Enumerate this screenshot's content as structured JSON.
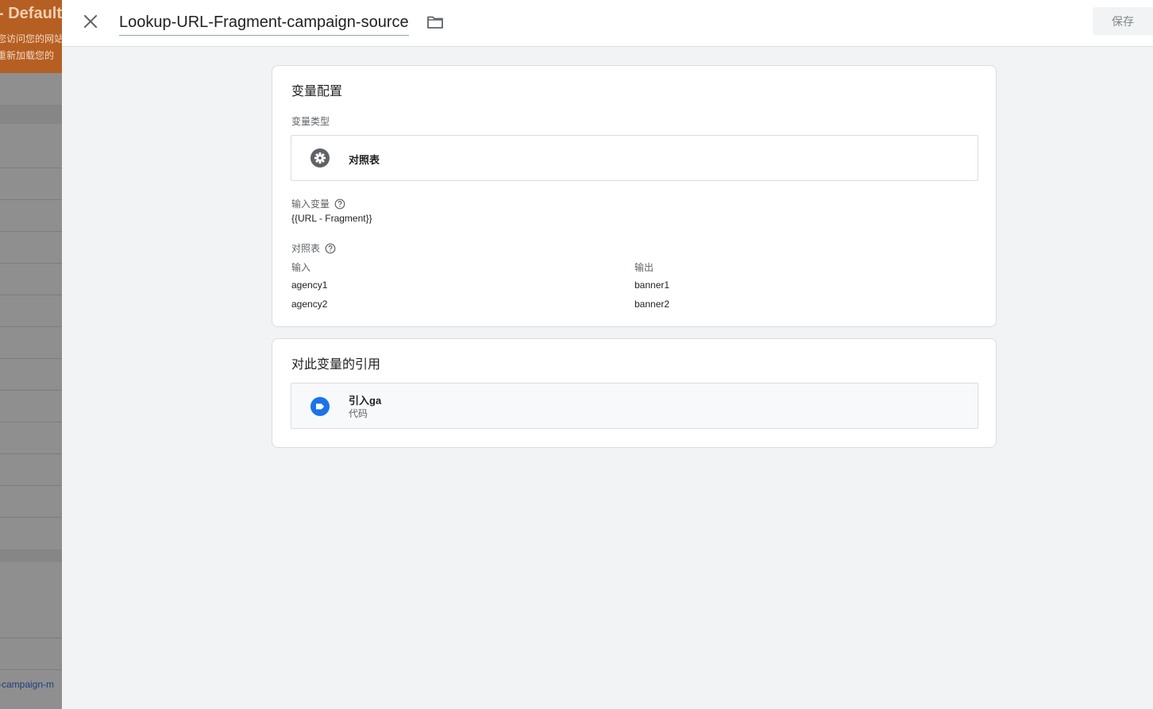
{
  "background": {
    "title": "- Default",
    "lines": [
      "您访问您的网站",
      "重新加载您的"
    ],
    "link": "-campaign-m"
  },
  "header": {
    "title": "Lookup-URL-Fragment-campaign-source",
    "save_label": "保存",
    "close_icon": "close-icon",
    "folder_icon": "folder-icon"
  },
  "config": {
    "heading": "变量配置",
    "type_label": "变量类型",
    "type_name": "对照表",
    "type_icon": "gear-icon",
    "input_var_label": "输入变量",
    "input_var_value": "{{URL - Fragment}}",
    "table_label": "对照表",
    "columns": [
      "输入",
      "输出"
    ],
    "rows": [
      {
        "input": "agency1",
        "output": "banner1"
      },
      {
        "input": "agency2",
        "output": "banner2"
      }
    ]
  },
  "references": {
    "heading": "对此变量的引用",
    "items": [
      {
        "name": "引入ga",
        "type": "代码",
        "icon": "tag-icon"
      }
    ]
  },
  "colors": {
    "accent": "#1a73e8",
    "banner": "#b65f22"
  }
}
